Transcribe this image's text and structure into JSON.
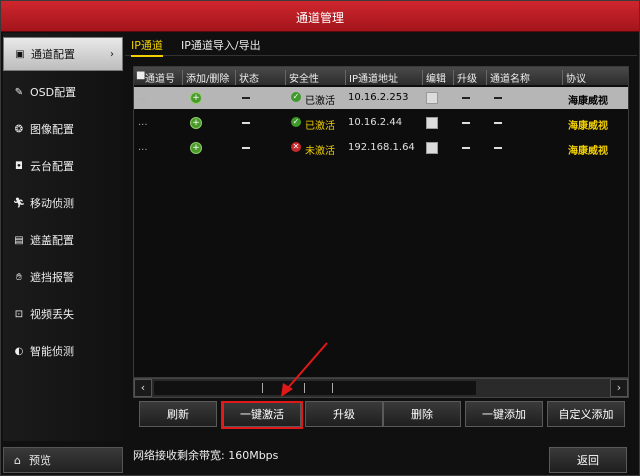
{
  "window": {
    "title": "通道管理"
  },
  "sidebar": {
    "items": [
      {
        "label": "通道配置",
        "icon": "channel-icon",
        "active": true
      },
      {
        "label": "OSD配置",
        "icon": "osd-icon"
      },
      {
        "label": "图像配置",
        "icon": "image-icon"
      },
      {
        "label": "云台配置",
        "icon": "ptz-icon"
      },
      {
        "label": "移动侦测",
        "icon": "motion-icon"
      },
      {
        "label": "遮盖配置",
        "icon": "mask-icon"
      },
      {
        "label": "遮挡报警",
        "icon": "hand-icon"
      },
      {
        "label": "视频丢失",
        "icon": "video-loss-icon"
      },
      {
        "label": "智能侦测",
        "icon": "smart-icon"
      }
    ],
    "arrow": "›",
    "preview_label": "预览"
  },
  "tabs": [
    {
      "label": "IP通道",
      "active": true
    },
    {
      "label": "IP通道导入/导出"
    }
  ],
  "table": {
    "headers": [
      "通道号",
      "添加/删除",
      "状态",
      "安全性",
      "IP通道地址",
      "编辑",
      "升级",
      "通道名称",
      "协议"
    ],
    "rows": [
      {
        "channel": "...",
        "security": "已激活",
        "security_ok": true,
        "ip": "10.16.2.253",
        "protocol": "海康威视",
        "selected": true
      },
      {
        "channel": "...",
        "security": "已激活",
        "security_ok": true,
        "ip": "10.16.2.44",
        "protocol": "海康威视"
      },
      {
        "channel": "...",
        "security": "未激活",
        "security_ok": false,
        "ip": "192.168.1.64",
        "protocol": "海康威视"
      }
    ]
  },
  "buttons": {
    "refresh": "刷新",
    "activate": "一键激活",
    "upgrade": "升级",
    "delete": "删除",
    "quick_add": "一键添加",
    "custom_add": "自定义添加",
    "back": "返回"
  },
  "bandwidth": "网络接收剩余带宽: 160Mbps",
  "colors": {
    "title_bar": "#c41e26",
    "accent": "#f2d000",
    "highlight": "#e01818"
  }
}
